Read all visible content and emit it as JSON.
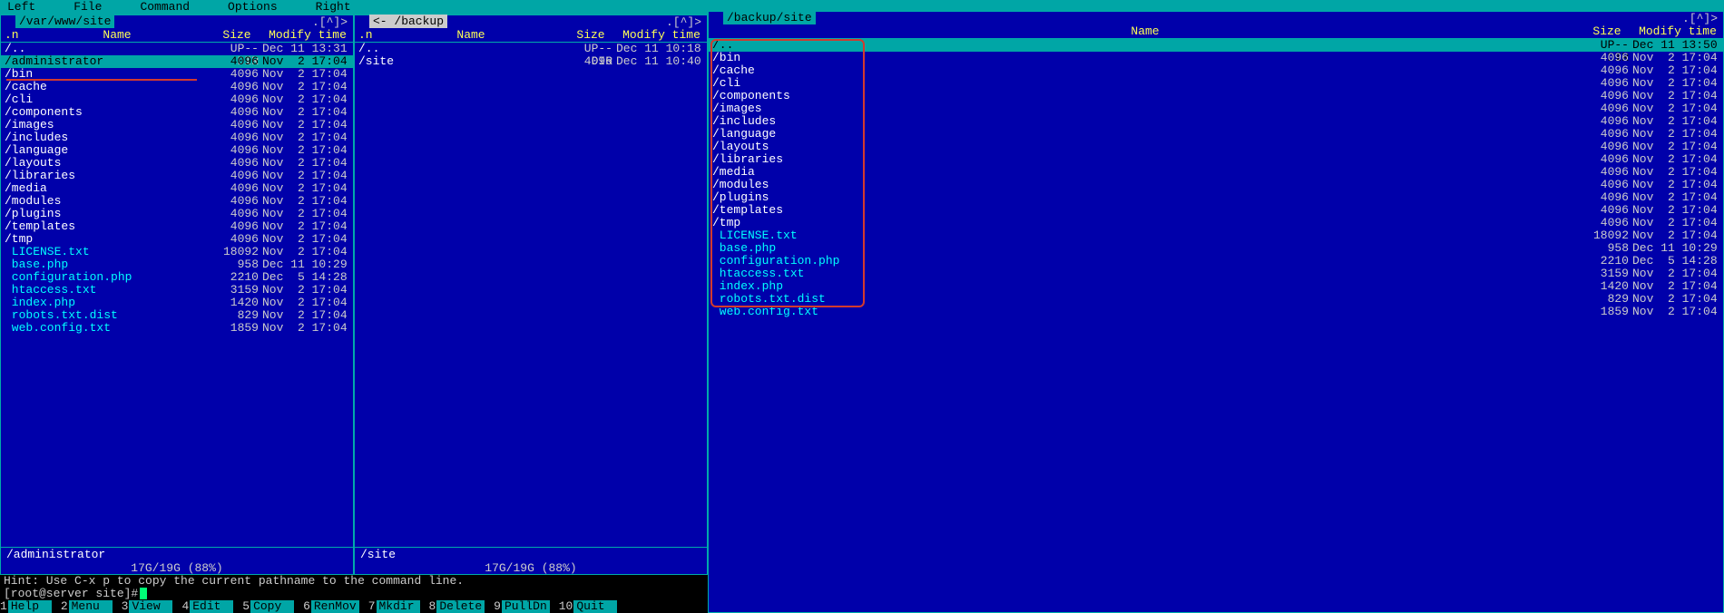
{
  "menubar": {
    "items": [
      "Left",
      "File",
      "Command",
      "Options",
      "Right"
    ]
  },
  "left_panel_1": {
    "path": "/var/www/site",
    "tail": ".[^]>",
    "headers": {
      "n": ".n",
      "name": "Name",
      "size": "Size",
      "mtime": "Modify time"
    },
    "rows": [
      {
        "name": "/..",
        "size": "UP--DIR",
        "mtime": "Dec 11 13:31",
        "type": "dir"
      },
      {
        "name": "/administrator",
        "size": "4096",
        "mtime": "Nov  2 17:04",
        "type": "dir",
        "selected": true
      },
      {
        "name": "/bin",
        "size": "4096",
        "mtime": "Nov  2 17:04",
        "type": "dir"
      },
      {
        "name": "/cache",
        "size": "4096",
        "mtime": "Nov  2 17:04",
        "type": "dir"
      },
      {
        "name": "/cli",
        "size": "4096",
        "mtime": "Nov  2 17:04",
        "type": "dir"
      },
      {
        "name": "/components",
        "size": "4096",
        "mtime": "Nov  2 17:04",
        "type": "dir"
      },
      {
        "name": "/images",
        "size": "4096",
        "mtime": "Nov  2 17:04",
        "type": "dir"
      },
      {
        "name": "/includes",
        "size": "4096",
        "mtime": "Nov  2 17:04",
        "type": "dir"
      },
      {
        "name": "/language",
        "size": "4096",
        "mtime": "Nov  2 17:04",
        "type": "dir"
      },
      {
        "name": "/layouts",
        "size": "4096",
        "mtime": "Nov  2 17:04",
        "type": "dir"
      },
      {
        "name": "/libraries",
        "size": "4096",
        "mtime": "Nov  2 17:04",
        "type": "dir"
      },
      {
        "name": "/media",
        "size": "4096",
        "mtime": "Nov  2 17:04",
        "type": "dir"
      },
      {
        "name": "/modules",
        "size": "4096",
        "mtime": "Nov  2 17:04",
        "type": "dir"
      },
      {
        "name": "/plugins",
        "size": "4096",
        "mtime": "Nov  2 17:04",
        "type": "dir"
      },
      {
        "name": "/templates",
        "size": "4096",
        "mtime": "Nov  2 17:04",
        "type": "dir"
      },
      {
        "name": "/tmp",
        "size": "4096",
        "mtime": "Nov  2 17:04",
        "type": "dir"
      },
      {
        "name": " LICENSE.txt",
        "size": "18092",
        "mtime": "Nov  2 17:04",
        "type": "file"
      },
      {
        "name": " base.php",
        "size": "958",
        "mtime": "Dec 11 10:29",
        "type": "file"
      },
      {
        "name": " configuration.php",
        "size": "2210",
        "mtime": "Dec  5 14:28",
        "type": "file"
      },
      {
        "name": " htaccess.txt",
        "size": "3159",
        "mtime": "Nov  2 17:04",
        "type": "file"
      },
      {
        "name": " index.php",
        "size": "1420",
        "mtime": "Nov  2 17:04",
        "type": "file"
      },
      {
        "name": " robots.txt.dist",
        "size": "829",
        "mtime": "Nov  2 17:04",
        "type": "file"
      },
      {
        "name": " web.config.txt",
        "size": "1859",
        "mtime": "Nov  2 17:04",
        "type": "file"
      }
    ],
    "footer": "/administrator",
    "disk": "17G/19G (88%)"
  },
  "left_panel_2": {
    "path": "<- /backup",
    "tail": ".[^]>",
    "headers": {
      "n": ".n",
      "name": "Name",
      "size": "Size",
      "mtime": "Modify time"
    },
    "rows": [
      {
        "name": "/..",
        "size": "UP--DIR",
        "mtime": "Dec 11 10:18",
        "type": "dir"
      },
      {
        "name": "/site",
        "size": "4096",
        "mtime": "Dec 11 10:40",
        "type": "dir"
      }
    ],
    "footer": "/site",
    "disk": "17G/19G (88%)"
  },
  "hint": "Hint: Use C-x p to copy the current pathname to the command line.",
  "prompt": "[root@server site]# ",
  "fkeys": [
    {
      "n": "1",
      "l": "Help"
    },
    {
      "n": "2",
      "l": "Menu"
    },
    {
      "n": "3",
      "l": "View"
    },
    {
      "n": "4",
      "l": "Edit"
    },
    {
      "n": "5",
      "l": "Copy"
    },
    {
      "n": "6",
      "l": "RenMov"
    },
    {
      "n": "7",
      "l": "Mkdir"
    },
    {
      "n": "8",
      "l": "Delete"
    },
    {
      "n": "9",
      "l": "PullDn"
    },
    {
      "n": "10",
      "l": "Quit"
    }
  ],
  "right_panel": {
    "path": "/backup/site",
    "tail": ".[^]>",
    "headers": {
      "name": "Name",
      "size": "Size",
      "mtime": "Modify time"
    },
    "rows": [
      {
        "name": "/..",
        "size": "UP--DIR",
        "mtime": "Dec 11 13:50",
        "type": "dir",
        "selected": true
      },
      {
        "name": "/bin",
        "size": "4096",
        "mtime": "Nov  2 17:04",
        "type": "dir"
      },
      {
        "name": "/cache",
        "size": "4096",
        "mtime": "Nov  2 17:04",
        "type": "dir"
      },
      {
        "name": "/cli",
        "size": "4096",
        "mtime": "Nov  2 17:04",
        "type": "dir"
      },
      {
        "name": "/components",
        "size": "4096",
        "mtime": "Nov  2 17:04",
        "type": "dir"
      },
      {
        "name": "/images",
        "size": "4096",
        "mtime": "Nov  2 17:04",
        "type": "dir"
      },
      {
        "name": "/includes",
        "size": "4096",
        "mtime": "Nov  2 17:04",
        "type": "dir"
      },
      {
        "name": "/language",
        "size": "4096",
        "mtime": "Nov  2 17:04",
        "type": "dir"
      },
      {
        "name": "/layouts",
        "size": "4096",
        "mtime": "Nov  2 17:04",
        "type": "dir"
      },
      {
        "name": "/libraries",
        "size": "4096",
        "mtime": "Nov  2 17:04",
        "type": "dir"
      },
      {
        "name": "/media",
        "size": "4096",
        "mtime": "Nov  2 17:04",
        "type": "dir"
      },
      {
        "name": "/modules",
        "size": "4096",
        "mtime": "Nov  2 17:04",
        "type": "dir"
      },
      {
        "name": "/plugins",
        "size": "4096",
        "mtime": "Nov  2 17:04",
        "type": "dir"
      },
      {
        "name": "/templates",
        "size": "4096",
        "mtime": "Nov  2 17:04",
        "type": "dir"
      },
      {
        "name": "/tmp",
        "size": "4096",
        "mtime": "Nov  2 17:04",
        "type": "dir"
      },
      {
        "name": " LICENSE.txt",
        "size": "18092",
        "mtime": "Nov  2 17:04",
        "type": "file"
      },
      {
        "name": " base.php",
        "size": "958",
        "mtime": "Dec 11 10:29",
        "type": "file"
      },
      {
        "name": " configuration.php",
        "size": "2210",
        "mtime": "Dec  5 14:28",
        "type": "file"
      },
      {
        "name": " htaccess.txt",
        "size": "3159",
        "mtime": "Nov  2 17:04",
        "type": "file"
      },
      {
        "name": " index.php",
        "size": "1420",
        "mtime": "Nov  2 17:04",
        "type": "file"
      },
      {
        "name": " robots.txt.dist",
        "size": "829",
        "mtime": "Nov  2 17:04",
        "type": "file"
      },
      {
        "name": " web.config.txt",
        "size": "1859",
        "mtime": "Nov  2 17:04",
        "type": "file"
      }
    ]
  }
}
